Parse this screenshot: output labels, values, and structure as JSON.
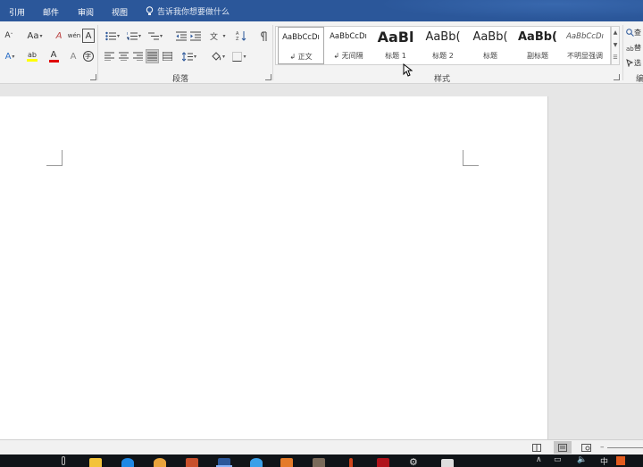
{
  "tabs": [
    "引用",
    "邮件",
    "审阅",
    "视图"
  ],
  "tell_me": "告诉我你想要做什么",
  "groups": {
    "paragraph": "段落",
    "styles": "样式"
  },
  "font_controls": {
    "shrink_font": "A",
    "change_case": "Aa",
    "clear_format": "A",
    "wen": "wén",
    "char_border": "A",
    "text_effects": "A",
    "highlight": "ab",
    "font_color": "A",
    "enclose": "字"
  },
  "styles": [
    {
      "sample": "AaBbCcDı",
      "name": "正文",
      "prefix": "↲",
      "selected": true
    },
    {
      "sample": "AaBbCcDı",
      "name": "无间隔",
      "prefix": "↲",
      "selected": false
    },
    {
      "sample": "AaBl",
      "name": "标题 1",
      "prefix": "",
      "selected": false
    },
    {
      "sample": "AaBb(",
      "name": "标题 2",
      "prefix": "",
      "selected": false
    },
    {
      "sample": "AaBb(",
      "name": "标题",
      "prefix": "",
      "selected": false
    },
    {
      "sample": "AaBb(",
      "name": "副标题",
      "prefix": "",
      "selected": false
    },
    {
      "sample": "AaBbCcDı",
      "name": "不明显强调",
      "prefix": "",
      "selected": false
    }
  ],
  "editing": {
    "find_label": "查",
    "replace_label": "替",
    "select_label": "选",
    "group_label": "编"
  },
  "gallery_scroll": {
    "up": "▲",
    "down": "▼",
    "more": "☰"
  },
  "colors": {
    "accent": "#2b579a",
    "font_color_bar": "#e00000",
    "highlight_bar": "#ffff00"
  },
  "taskbar": {
    "apps": [
      "file-explorer",
      "edge",
      "chrome",
      "powerpoint",
      "word",
      "qq",
      "wps",
      "app-7",
      "app-8",
      "app-9",
      "settings",
      "app-11"
    ],
    "tray": [
      "∧",
      "▭",
      "🔈",
      "中"
    ]
  }
}
